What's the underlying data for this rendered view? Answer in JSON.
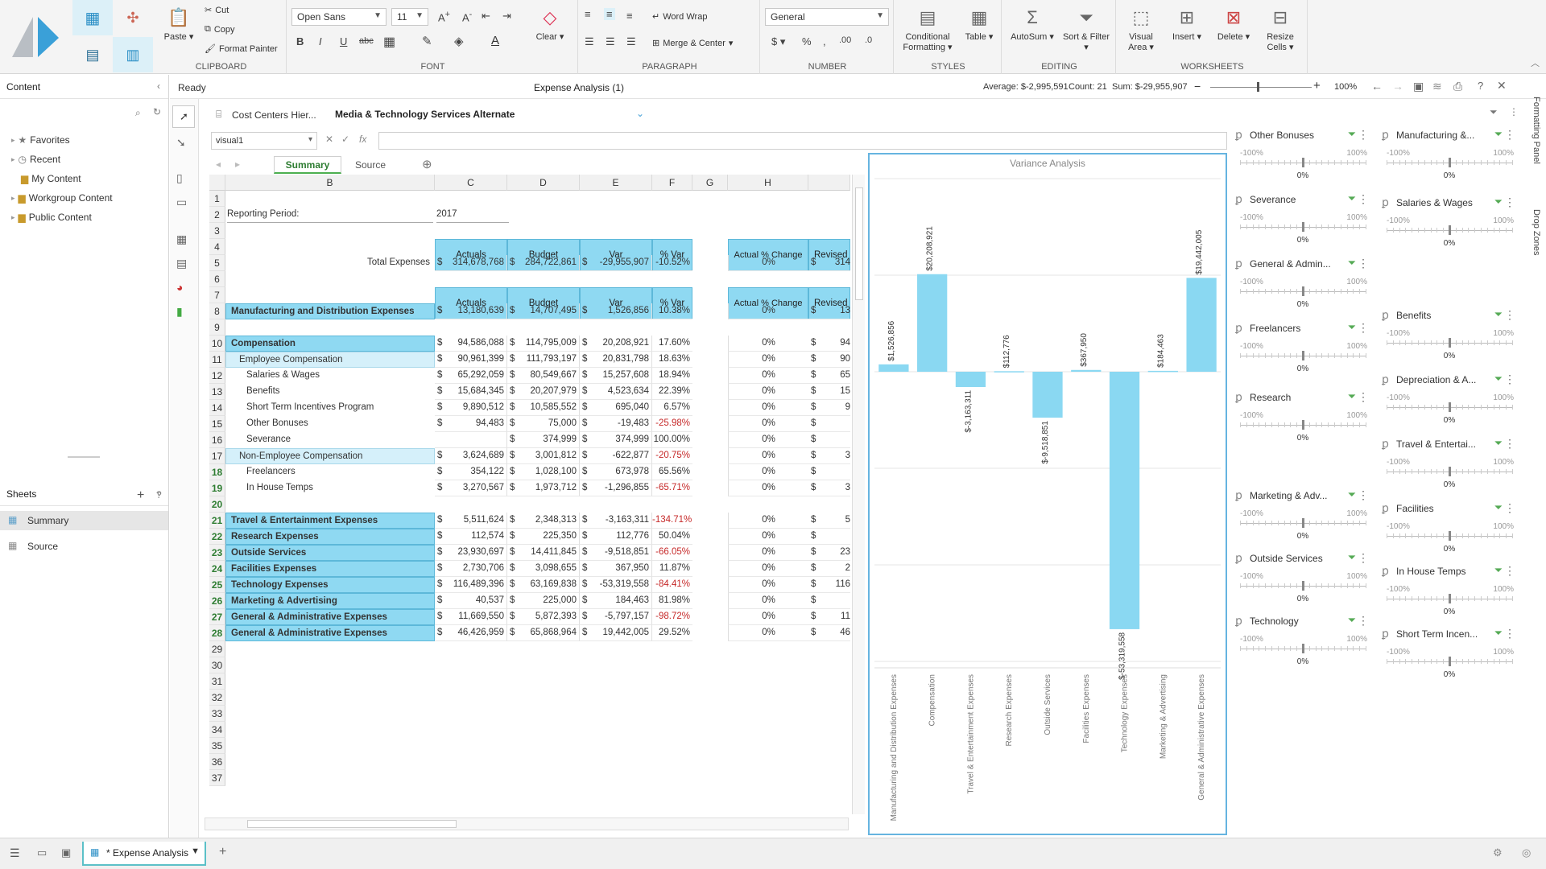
{
  "ribbon": {
    "clipboard": {
      "paste": "Paste ▾",
      "cut": "Cut",
      "copy": "Copy",
      "format_painter": "Format Painter",
      "label": "CLIPBOARD"
    },
    "font": {
      "family": "Open Sans",
      "size": "11",
      "label": "FONT"
    },
    "paragraph": {
      "word_wrap": "Word Wrap",
      "merge_center": "Merge & Center",
      "label": "PARAGRAPH"
    },
    "number": {
      "format": "General",
      "label": "NUMBER"
    },
    "styles": {
      "conditional": "Conditional Formatting ▾",
      "table": "Table ▾",
      "label": "STYLES"
    },
    "editing": {
      "autosum": "AutoSum ▾",
      "sort_filter": "Sort & Filter ▾",
      "clear": "Clear ▾",
      "label": "EDITING"
    },
    "worksheets": {
      "visual_area": "Visual Area ▾",
      "insert": "Insert ▾",
      "delete": "Delete ▾",
      "resize": "Resize Cells ▾",
      "label": "WORKSHEETS"
    }
  },
  "content_panel": {
    "title": "Content",
    "items": [
      "Favorites",
      "Recent",
      "My Content",
      "Workgroup Content",
      "Public Content"
    ]
  },
  "sheets_panel": {
    "title": "Sheets",
    "items": [
      "Summary",
      "Source"
    ]
  },
  "status": {
    "ready": "Ready",
    "title": "Expense Analysis (1)",
    "average": "Average: $-2,995,591",
    "count": "Count: 21",
    "sum": "Sum: $-29,955,907",
    "zoom": "100%"
  },
  "hierarchy": {
    "label": "Cost Centers Hier...",
    "value": "Media & Technology Services Alternate"
  },
  "formula": {
    "namebox": "visual1",
    "value": ""
  },
  "tabs": [
    "Summary",
    "Source"
  ],
  "columns": [
    "B",
    "C",
    "D",
    "E",
    "F",
    "G",
    "H"
  ],
  "columns_extra": "",
  "rows": [
    "1",
    "2",
    "3",
    "4",
    "5",
    "6",
    "7",
    "8",
    "9",
    "10",
    "11",
    "12",
    "13",
    "14",
    "15",
    "16",
    "17",
    "18",
    "19",
    "20",
    "21",
    "22",
    "23",
    "24",
    "25",
    "26",
    "27",
    "28",
    "29",
    "30",
    "31",
    "32",
    "33",
    "34",
    "35",
    "36",
    "37"
  ],
  "sheet": {
    "reporting_label": "Reporting Period:",
    "reporting_value": "2017",
    "headers": {
      "actuals": "Actuals",
      "budget": "Budget",
      "var": "Var",
      "pct_var": "% Var",
      "actual_change": "Actual % Change",
      "revised": "Revised"
    },
    "total": {
      "label": "Total Expenses",
      "actuals": "314,678,768",
      "budget": "284,722,861",
      "var": "-29,955,907",
      "pct": "-10.52%",
      "change": "0%",
      "revised": "314"
    },
    "lines": [
      {
        "row": 8,
        "label": "Manufacturing and Distribution Expenses",
        "style": "blue",
        "indent": 0,
        "actuals": "13,180,639",
        "budget": "14,707,495",
        "var": "1,526,856",
        "pct": "10.38%",
        "change": "0%",
        "revised": "13"
      },
      {
        "row": 10,
        "label": "Compensation",
        "style": "blue",
        "indent": 0,
        "actuals": "94,586,088",
        "budget": "114,795,009",
        "var": "20,208,921",
        "pct": "17.60%",
        "change": "0%",
        "revised": "94"
      },
      {
        "row": 11,
        "label": "Employee Compensation",
        "style": "light",
        "indent": 1,
        "actuals": "90,961,399",
        "budget": "111,793,197",
        "var": "20,831,798",
        "pct": "18.63%",
        "change": "0%",
        "revised": "90"
      },
      {
        "row": 12,
        "label": "Salaries & Wages",
        "style": "none",
        "indent": 2,
        "actuals": "65,292,059",
        "budget": "80,549,667",
        "var": "15,257,608",
        "pct": "18.94%",
        "change": "0%",
        "revised": "65"
      },
      {
        "row": 13,
        "label": "Benefits",
        "style": "none",
        "indent": 2,
        "actuals": "15,684,345",
        "budget": "20,207,979",
        "var": "4,523,634",
        "pct": "22.39%",
        "change": "0%",
        "revised": "15"
      },
      {
        "row": 14,
        "label": "Short Term Incentives Program",
        "style": "none",
        "indent": 2,
        "actuals": "9,890,512",
        "budget": "10,585,552",
        "var": "695,040",
        "pct": "6.57%",
        "change": "0%",
        "revised": "9"
      },
      {
        "row": 15,
        "label": "Other Bonuses",
        "style": "none",
        "indent": 2,
        "actuals": "94,483",
        "budget": "75,000",
        "var": "-19,483",
        "pct": "-25.98%",
        "change": "0%",
        "revised": ""
      },
      {
        "row": 16,
        "label": "Severance",
        "style": "none",
        "indent": 2,
        "actuals": "",
        "budget": "374,999",
        "var": "374,999",
        "pct": "100.00%",
        "change": "0%",
        "revised": ""
      },
      {
        "row": 17,
        "label": "Non-Employee Compensation",
        "style": "light",
        "indent": 1,
        "actuals": "3,624,689",
        "budget": "3,001,812",
        "var": "-622,877",
        "pct": "-20.75%",
        "change": "0%",
        "revised": "3"
      },
      {
        "row": 18,
        "label": "Freelancers",
        "style": "none",
        "indent": 2,
        "actuals": "354,122",
        "budget": "1,028,100",
        "var": "673,978",
        "pct": "65.56%",
        "change": "0%",
        "revised": ""
      },
      {
        "row": 19,
        "label": "In House Temps",
        "style": "none",
        "indent": 2,
        "actuals": "3,270,567",
        "budget": "1,973,712",
        "var": "-1,296,855",
        "pct": "-65.71%",
        "change": "0%",
        "revised": "3"
      },
      {
        "row": 21,
        "label": "Travel & Entertainment Expenses",
        "style": "blue",
        "indent": 0,
        "actuals": "5,511,624",
        "budget": "2,348,313",
        "var": "-3,163,311",
        "pct": "-134.71%",
        "change": "0%",
        "revised": "5"
      },
      {
        "row": 22,
        "label": "Research Expenses",
        "style": "blue",
        "indent": 0,
        "actuals": "112,574",
        "budget": "225,350",
        "var": "112,776",
        "pct": "50.04%",
        "change": "0%",
        "revised": ""
      },
      {
        "row": 23,
        "label": "Outside Services",
        "style": "blue",
        "indent": 0,
        "actuals": "23,930,697",
        "budget": "14,411,845",
        "var": "-9,518,851",
        "pct": "-66.05%",
        "change": "0%",
        "revised": "23"
      },
      {
        "row": 24,
        "label": "Facilities Expenses",
        "style": "blue",
        "indent": 0,
        "actuals": "2,730,706",
        "budget": "3,098,655",
        "var": "367,950",
        "pct": "11.87%",
        "change": "0%",
        "revised": "2"
      },
      {
        "row": 25,
        "label": "Technology Expenses",
        "style": "blue",
        "indent": 0,
        "actuals": "116,489,396",
        "budget": "63,169,838",
        "var": "-53,319,558",
        "pct": "-84.41%",
        "change": "0%",
        "revised": "116"
      },
      {
        "row": 26,
        "label": "Marketing & Advertising",
        "style": "blue",
        "indent": 0,
        "actuals": "40,537",
        "budget": "225,000",
        "var": "184,463",
        "pct": "81.98%",
        "change": "0%",
        "revised": ""
      },
      {
        "row": 27,
        "label": "General & Administrative Expenses",
        "style": "blue",
        "indent": 0,
        "actuals": "11,669,550",
        "budget": "5,872,393",
        "var": "-5,797,157",
        "pct": "-98.72%",
        "change": "0%",
        "revised": "11"
      },
      {
        "row": 28,
        "label": "General & Administrative Expenses",
        "style": "blue",
        "indent": 0,
        "actuals": "46,426,959",
        "budget": "65,868,964",
        "var": "19,442,005",
        "pct": "29.52%",
        "change": "0%",
        "revised": "46"
      }
    ]
  },
  "chart_data": {
    "type": "bar",
    "title": "Variance Analysis",
    "categories": [
      "Manufacturing and Distribution Expenses",
      "Compensation",
      "Travel & Entertainment Expenses",
      "Research Expenses",
      "Outside Services",
      "Facilities Expenses",
      "Technology Expenses",
      "Marketing & Advertising",
      "General & Administrative Expenses"
    ],
    "values": [
      1526856,
      20208921,
      -3163311,
      112776,
      -9518851,
      367950,
      -53319558,
      184463,
      19442005
    ],
    "labels": [
      "$1,526,856",
      "$20,208,921",
      "$-3,163,311",
      "$112,776",
      "$-9,518,851",
      "$367,950",
      "$-53,319,558",
      "$184,463",
      "$19,442,005"
    ],
    "ylim": [
      -60000000,
      40000000
    ],
    "grid": true,
    "color": "#8ad8f2"
  },
  "filters": [
    {
      "name": "Other Bonuses",
      "value": "0%"
    },
    {
      "name": "Manufacturing &...",
      "value": "0%"
    },
    {
      "name": "Severance",
      "value": "0%"
    },
    {
      "name": "Salaries & Wages",
      "value": "0%"
    },
    {
      "name": "General & Admin...",
      "value": "0%"
    },
    {
      "name": "Benefits",
      "value": "0%"
    },
    {
      "name": "Freelancers",
      "value": "0%"
    },
    {
      "name": "Depreciation & A...",
      "value": "0%"
    },
    {
      "name": "Research",
      "value": "0%"
    },
    {
      "name": "Travel & Entertai...",
      "value": "0%"
    },
    {
      "name": "Marketing & Adv...",
      "value": "0%"
    },
    {
      "name": "Facilities",
      "value": "0%"
    },
    {
      "name": "Outside Services",
      "value": "0%"
    },
    {
      "name": "In House Temps",
      "value": "0%"
    },
    {
      "name": "Technology",
      "value": "0%"
    },
    {
      "name": "Short Term Incen...",
      "value": "0%"
    }
  ],
  "filter_range": {
    "min": "-100%",
    "max": "100%"
  },
  "side_tabs": {
    "formatting": "Formatting Panel",
    "drop": "Drop Zones"
  },
  "bottom": {
    "tab": "* Expense Analysis"
  }
}
